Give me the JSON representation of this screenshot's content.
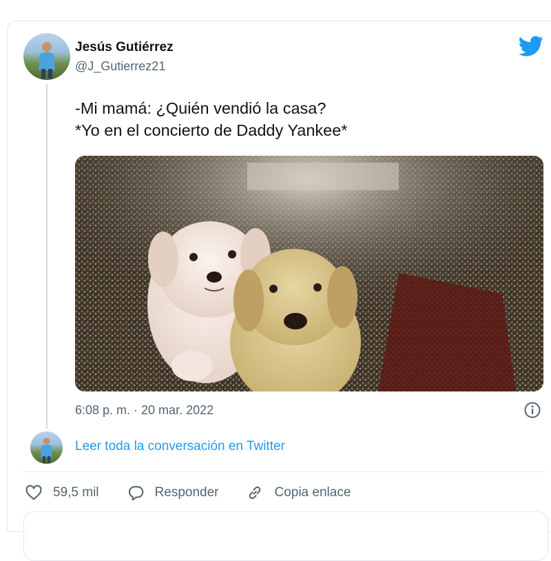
{
  "tweet": {
    "author_name": "Jesús Gutiérrez",
    "handle": "@J_Gutierrez21",
    "text_lines": [
      "-Mi mamá: ¿Quién vendió la casa?",
      "*Yo en el concierto de Daddy Yankee*"
    ],
    "media_description_icon": "photo-two-puppies-concert-crowd",
    "timestamp": "6:08 p. m. · 20 mar. 2022"
  },
  "conversation_link": "Leer toda la conversación en Twitter",
  "actions": {
    "like_count": "59,5 mil",
    "reply_label": "Responder",
    "copy_link_label": "Copia enlace"
  },
  "icons": {
    "brand": "twitter-bird-icon",
    "info": "info-icon",
    "like": "heart-icon",
    "reply": "speech-bubble-icon",
    "copy": "link-icon"
  },
  "colors": {
    "accent": "#1d9bf0",
    "text": "#0f1419",
    "secondary_text": "#536471",
    "border": "#e1e8ed"
  }
}
